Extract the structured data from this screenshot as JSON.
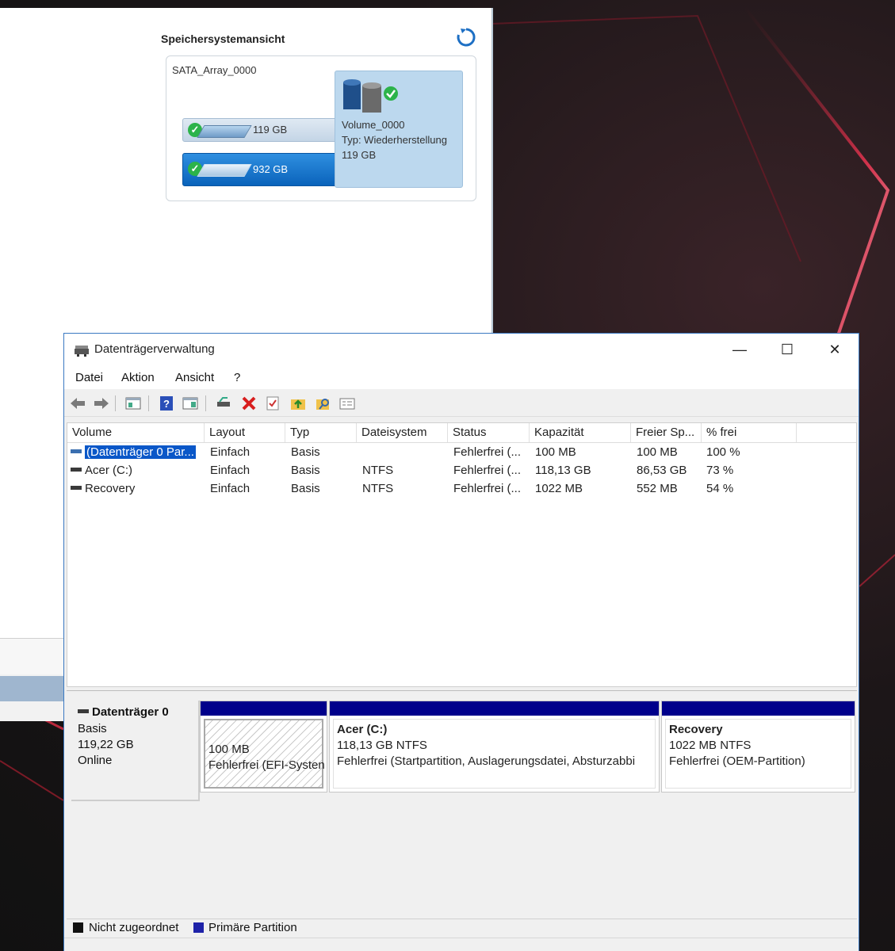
{
  "background_app": {
    "panel_title": "Speichersystemansicht",
    "array_name": "SATA_Array_0000",
    "disks": [
      {
        "size": "119 GB"
      },
      {
        "size": "932 GB"
      }
    ],
    "volume": {
      "name": "Volume_0000",
      "type": "Typ: Wiederherstellung",
      "size": "119 GB"
    }
  },
  "window": {
    "title": "Datenträgerverwaltung",
    "controls": {
      "minimize": "—",
      "maximize": "☐",
      "close": "✕"
    }
  },
  "menu": [
    "Datei",
    "Aktion",
    "Ansicht",
    "?"
  ],
  "toolbar_icons": [
    "back-arrow-icon",
    "forward-arrow-icon",
    "console-tree-icon",
    "help-icon",
    "action-pane-icon",
    "connect-icon",
    "delete-icon",
    "check-icon",
    "folder-up-icon",
    "search-folder-icon",
    "properties-icon"
  ],
  "table": {
    "columns": [
      "Volume",
      "Layout",
      "Typ",
      "Dateisystem",
      "Status",
      "Kapazität",
      "Freier Sp...",
      "% frei"
    ],
    "rows": [
      {
        "volume": "(Datenträger 0 Par...",
        "layout": "Einfach",
        "typ": "Basis",
        "dateisystem": "",
        "status": "Fehlerfrei (...",
        "kapazitaet": "100 MB",
        "frei": "100 MB",
        "prozent": "100 %"
      },
      {
        "volume": "Acer (C:)",
        "layout": "Einfach",
        "typ": "Basis",
        "dateisystem": "NTFS",
        "status": "Fehlerfrei (...",
        "kapazitaet": "118,13 GB",
        "frei": "86,53 GB",
        "prozent": "73 %"
      },
      {
        "volume": "Recovery",
        "layout": "Einfach",
        "typ": "Basis",
        "dateisystem": "NTFS",
        "status": "Fehlerfrei (...",
        "kapazitaet": "1022 MB",
        "frei": "552 MB",
        "prozent": "54 %"
      }
    ]
  },
  "disk": {
    "name": "Datenträger 0",
    "type": "Basis",
    "size": "119,22 GB",
    "state": "Online",
    "partitions": [
      {
        "title": "",
        "size": "100 MB",
        "status": "Fehlerfrei (EFI-Systen"
      },
      {
        "title": "Acer  (C:)",
        "size": "118,13 GB NTFS",
        "status": "Fehlerfrei (Startpartition, Auslagerungsdatei, Absturzabbi"
      },
      {
        "title": "Recovery",
        "size": "1022 MB NTFS",
        "status": "Fehlerfrei (OEM-Partition)"
      }
    ]
  },
  "legend": [
    {
      "label": "Nicht zugeordnet",
      "color": "#111111"
    },
    {
      "label": "Primäre Partition",
      "color": "#1e22a8"
    }
  ],
  "colors": {
    "partition_header": "#00008b",
    "selection": "#0a57c8",
    "window_border": "#3b79c2"
  }
}
